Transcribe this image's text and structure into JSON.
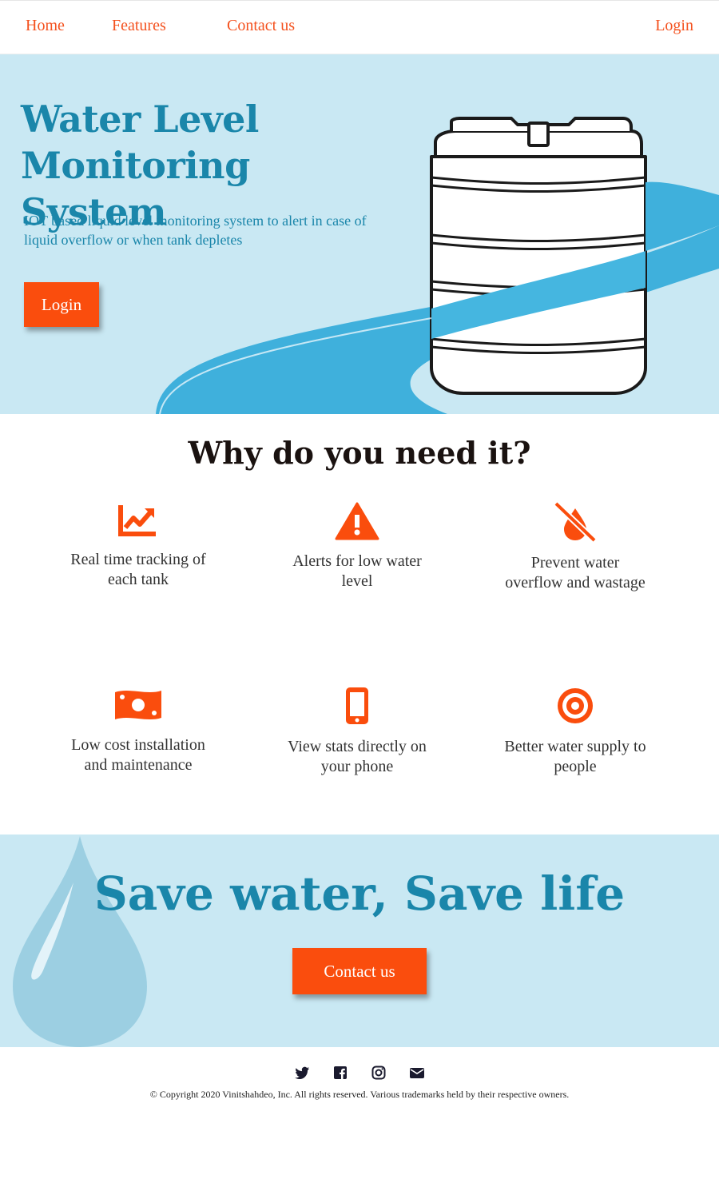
{
  "nav": {
    "home": "Home",
    "features": "Features",
    "contact": "Contact us",
    "login": "Login"
  },
  "hero": {
    "title_line1": "Water Level",
    "title_line2": "Monitoring System",
    "subtitle": "IOT based liquid level monitoring system to alert in case of liquid overflow or when tank depletes",
    "login_button": "Login",
    "illustration": "water-tank-with-stream"
  },
  "why": {
    "title": "Why do you need it?",
    "features": [
      {
        "icon": "chart-line-icon",
        "text": "Real time tracking of each tank"
      },
      {
        "icon": "warning-icon",
        "text": "Alerts for low water level"
      },
      {
        "icon": "no-water-drop-icon",
        "text": "Prevent water overflow and wastage"
      },
      {
        "icon": "money-bill-icon",
        "text": "Low cost installation and maintenance"
      },
      {
        "icon": "mobile-phone-icon",
        "text": "View stats directly on your phone"
      },
      {
        "icon": "target-icon",
        "text": "Better water supply to people"
      }
    ]
  },
  "save": {
    "title": "Save water, Save life",
    "contact_button": "Contact us"
  },
  "footer": {
    "social_icons": [
      "twitter-icon",
      "facebook-icon",
      "instagram-icon",
      "email-icon"
    ],
    "copyright": "© Copyright 2020 Vinitshahdeo, Inc. All rights reserved. Various trademarks held by their respective owners."
  },
  "colors": {
    "accent": "#fa4d0d",
    "brand_blue": "#1a86aa",
    "light_blue_bg": "#c9e8f3",
    "stream_blue": "#3fb0dc"
  }
}
